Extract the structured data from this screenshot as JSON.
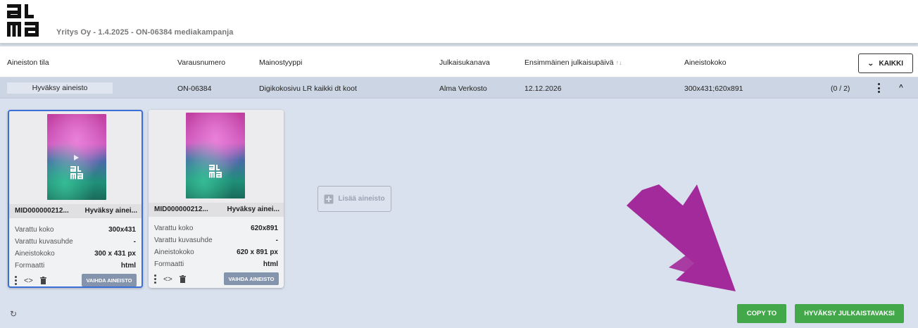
{
  "header": {
    "logo_text": "alma",
    "title": "Yritys Oy - 1.4.2025 - ON-06384 mediakampanja"
  },
  "table": {
    "columns": [
      "Aineiston tila",
      "Varausnumero",
      "Mainostyyppi",
      "Julkaisukanava",
      "Ensimmäinen julkaisupäivä",
      "Aineistokoko"
    ],
    "filter_label": "KAIKKI",
    "row": {
      "status": "Hyväksy aineisto",
      "reservation": "ON-06384",
      "ad_type": "Digikokosivu LR kaikki dt koot",
      "channel": "Alma Verkosto",
      "first_date": "12.12.2026",
      "sizes": "300x431;620x891",
      "count": "(0 / 2)"
    }
  },
  "cards": [
    {
      "id": "MID000000212...",
      "status": "Hyväksy ainei...",
      "specs": [
        {
          "label": "Varattu koko",
          "value": "300x431"
        },
        {
          "label": "Varattu kuvasuhde",
          "value": "-"
        },
        {
          "label": "Aineistokoko",
          "value": "300 x 431 px"
        },
        {
          "label": "Formaatti",
          "value": "html"
        }
      ],
      "replace_label": "VAIHDA AINEISTO"
    },
    {
      "id": "MID000000212...",
      "status": "Hyväksy ainei...",
      "specs": [
        {
          "label": "Varattu koko",
          "value": "620x891"
        },
        {
          "label": "Varattu kuvasuhde",
          "value": "-"
        },
        {
          "label": "Aineistokoko",
          "value": "620 x 891 px"
        },
        {
          "label": "Formaatti",
          "value": "html"
        }
      ],
      "replace_label": "VAIHDA AINEISTO"
    }
  ],
  "add_material_label": "Lisää aineisto",
  "actions": {
    "copy_label": "COPY TO",
    "approve_label": "HYVÄKSY JULKAISTAVAKSI"
  },
  "colors": {
    "accent_green": "#43a84a",
    "selected_border": "#3b6fd8",
    "annotation_arrow": "#a32a9a"
  }
}
